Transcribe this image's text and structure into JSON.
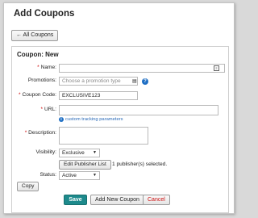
{
  "page": {
    "title": "Add Coupons",
    "back_button": "← All Coupons"
  },
  "form": {
    "heading": "Coupon: New",
    "required_mark": "*",
    "name": {
      "label": "Name:",
      "value": ""
    },
    "promotions": {
      "label": "Promotions:",
      "placeholder": "Choose a promotion type"
    },
    "coupon_code": {
      "label": "Coupon Code:",
      "value": "EXCLUSIVE123"
    },
    "url": {
      "label": "URL:",
      "value": "",
      "help_link": "custom tracking parameters"
    },
    "description": {
      "label": "Description:",
      "value": ""
    },
    "visibility": {
      "label": "Visibility:",
      "selected": "Exclusive"
    },
    "publisher": {
      "button": "Edit Publisher List",
      "status": "1 publisher(s) selected."
    },
    "status": {
      "label": "Status:",
      "selected": "Active"
    },
    "copy_button": "Copy"
  },
  "actions": {
    "save": "Save",
    "add_new": "Add New Coupon",
    "cancel": "Cancel"
  },
  "colors": {
    "save_bg": "#1d8a8c",
    "cancel_text": "#cc1111",
    "link": "#2a6ab8",
    "required": "#cc0000"
  }
}
